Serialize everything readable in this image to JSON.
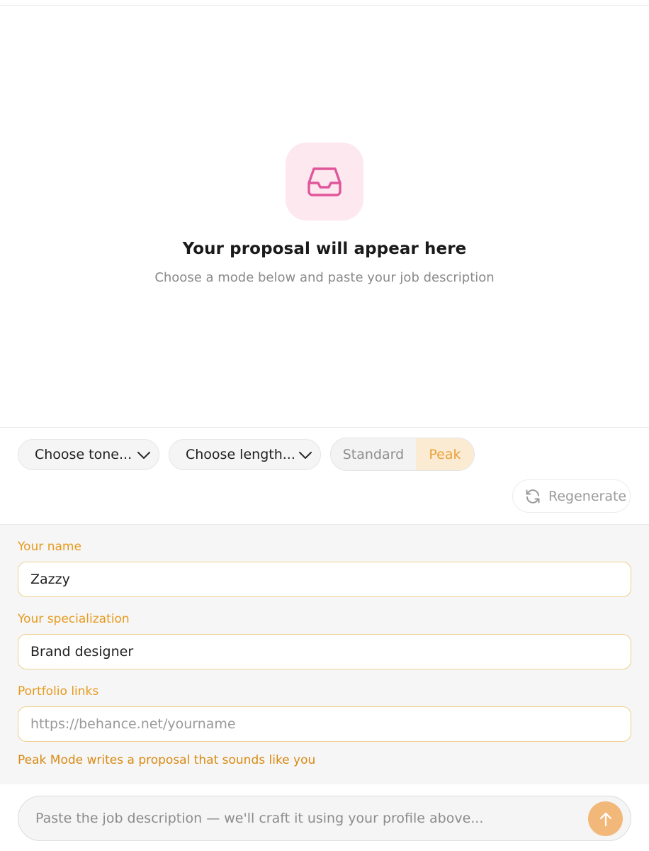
{
  "empty_state": {
    "icon": "inbox-icon",
    "title": "Your proposal will appear here",
    "subtitle": "Choose a mode below and paste your job description"
  },
  "controls": {
    "tone_select": {
      "value": "Choose tone...",
      "icon": "chevron-down-icon"
    },
    "length_select": {
      "value": "Choose length...",
      "icon": "chevron-down-icon"
    },
    "mode_toggle": {
      "options": [
        "Standard",
        "Peak"
      ],
      "selected": "Peak"
    },
    "regenerate": {
      "label": "Regenerate",
      "icon": "refresh-icon"
    }
  },
  "profile": {
    "name": {
      "label": "Your name",
      "value": "Zazzy"
    },
    "specialization": {
      "label": "Your specialization",
      "value": "Brand designer"
    },
    "portfolio": {
      "label": "Portfolio links",
      "value": "",
      "placeholder": "https://behance.net/yourname"
    },
    "hint": "Peak Mode writes a proposal that sounds like you"
  },
  "composer": {
    "placeholder": "Paste the job description — we'll craft it using your profile above...",
    "value": "",
    "send_icon": "arrow-up-icon"
  },
  "colors": {
    "accent": "#e69a1c",
    "accent_soft": "#fcebd3",
    "pink_icon": "#e0569b",
    "pink_bg": "#fde8ef",
    "send_button": "#f2b87a"
  }
}
